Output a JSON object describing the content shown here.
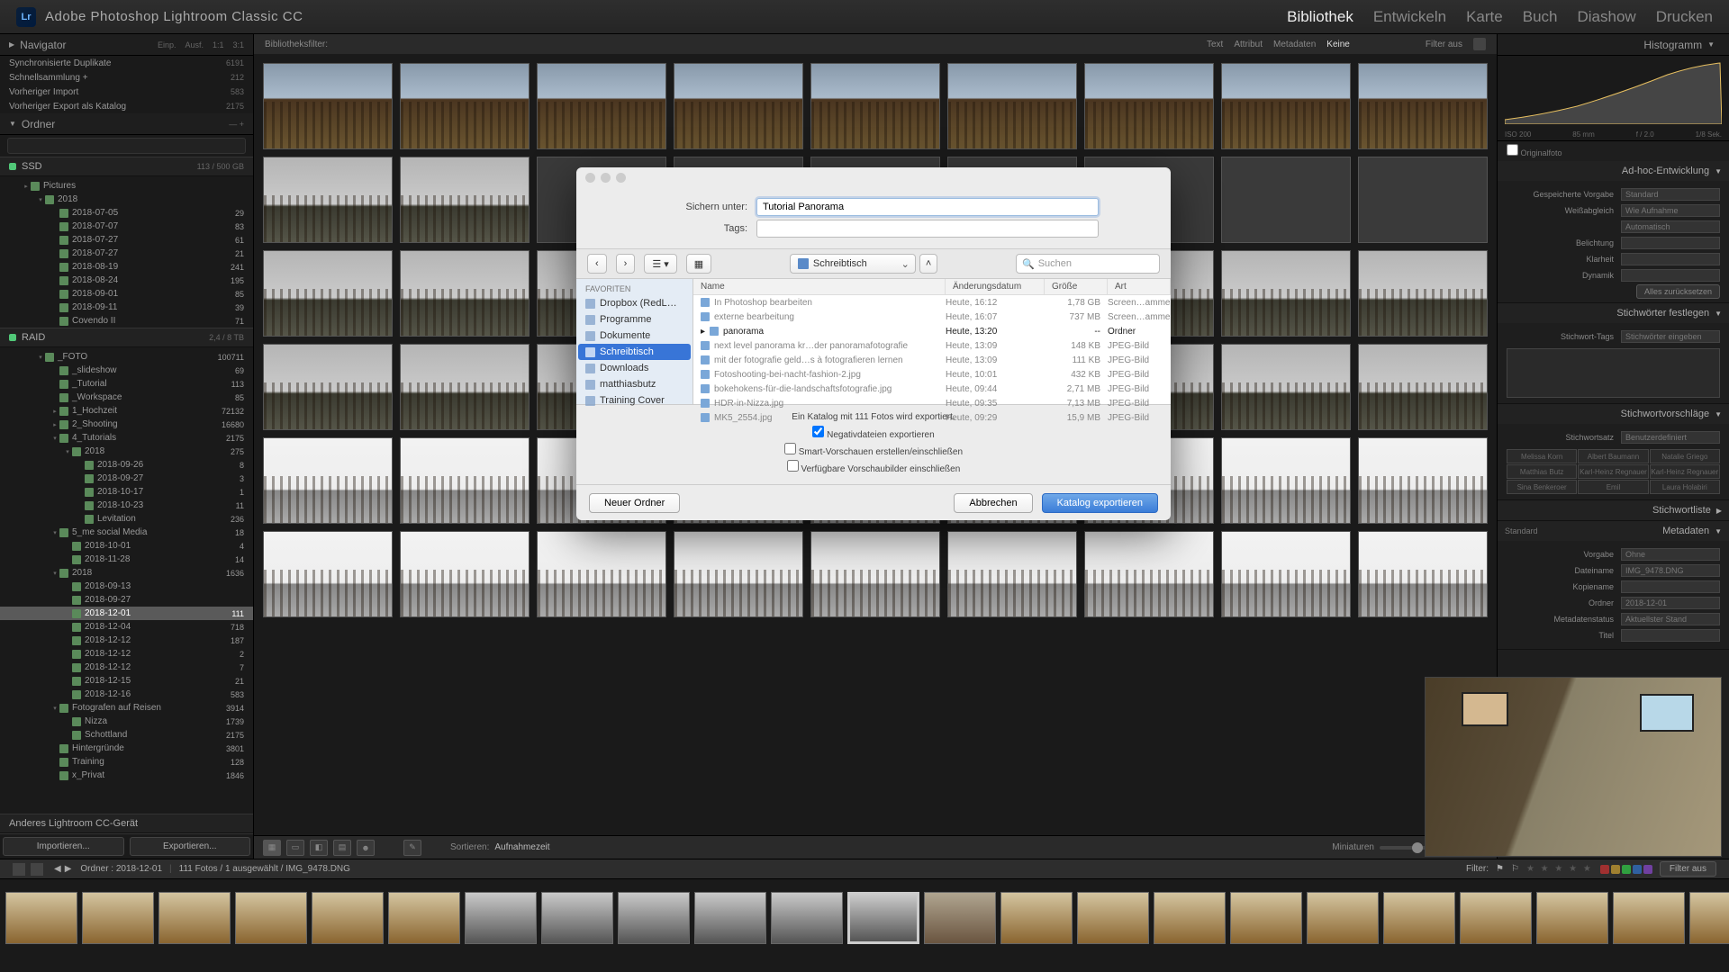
{
  "app": {
    "logo": "Lr",
    "title": "Adobe Photoshop Lightroom Classic CC"
  },
  "modules": [
    "Bibliothek",
    "Entwickeln",
    "Karte",
    "Buch",
    "Diashow",
    "Drucken"
  ],
  "activeModule": 0,
  "leftPanels": {
    "navigator": {
      "title": "Navigator",
      "fit": "Einp.",
      "fill": "Ausf.",
      "r1": "1:1",
      "r2": "3:1"
    },
    "catalog": {
      "items": [
        {
          "name": "Synchronisierte Duplikate",
          "count": "6191"
        },
        {
          "name": "Schnellsammlung  +",
          "count": "212"
        },
        {
          "name": "Vorheriger Import",
          "count": "583"
        },
        {
          "name": "Vorheriger Export als Katalog",
          "count": "2175"
        }
      ]
    },
    "folders": {
      "title": "Ordner",
      "plus": "+"
    },
    "volumes": [
      {
        "name": "SSD",
        "info": "113 / 500 GB"
      },
      {
        "name": "RAID",
        "info": "2,4 / 8 TB"
      }
    ],
    "tree": [
      {
        "pad": 24,
        "exp": "▸",
        "name": "Pictures",
        "count": ""
      },
      {
        "pad": 40,
        "exp": "▾",
        "name": "2018",
        "count": ""
      },
      {
        "pad": 56,
        "exp": "",
        "name": "2018-07-05",
        "count": "29"
      },
      {
        "pad": 56,
        "exp": "",
        "name": "2018-07-07",
        "count": "83"
      },
      {
        "pad": 56,
        "exp": "",
        "name": "2018-07-27",
        "count": "61"
      },
      {
        "pad": 56,
        "exp": "",
        "name": "2018-07-27",
        "count": "21"
      },
      {
        "pad": 56,
        "exp": "",
        "name": "2018-08-19",
        "count": "241"
      },
      {
        "pad": 56,
        "exp": "",
        "name": "2018-08-24",
        "count": "195"
      },
      {
        "pad": 56,
        "exp": "",
        "name": "2018-09-01",
        "count": "85"
      },
      {
        "pad": 56,
        "exp": "",
        "name": "2018-09-11",
        "count": "39"
      },
      {
        "pad": 56,
        "exp": "",
        "name": "Covendo II",
        "count": "71"
      }
    ],
    "tree2": [
      {
        "pad": 40,
        "exp": "▾",
        "name": "_FOTO",
        "count": "100711"
      },
      {
        "pad": 56,
        "exp": "",
        "name": "_slideshow",
        "count": "69"
      },
      {
        "pad": 56,
        "exp": "",
        "name": "_Tutorial",
        "count": "113"
      },
      {
        "pad": 56,
        "exp": "",
        "name": "_Workspace",
        "count": "85"
      },
      {
        "pad": 56,
        "exp": "▸",
        "name": "1_Hochzeit",
        "count": "72132"
      },
      {
        "pad": 56,
        "exp": "▸",
        "name": "2_Shooting",
        "count": "16680"
      },
      {
        "pad": 56,
        "exp": "▾",
        "name": "4_Tutorials",
        "count": "2175"
      },
      {
        "pad": 70,
        "exp": "▾",
        "name": "2018",
        "count": "275"
      },
      {
        "pad": 84,
        "exp": "",
        "name": "2018-09-26",
        "count": "8"
      },
      {
        "pad": 84,
        "exp": "",
        "name": "2018-09-27",
        "count": "3"
      },
      {
        "pad": 84,
        "exp": "",
        "name": "2018-10-17",
        "count": "1"
      },
      {
        "pad": 84,
        "exp": "",
        "name": "2018-10-23",
        "count": "11"
      },
      {
        "pad": 84,
        "exp": "",
        "name": "Levitation",
        "count": "236"
      },
      {
        "pad": 56,
        "exp": "▾",
        "name": "5_me social Media",
        "count": "18"
      },
      {
        "pad": 70,
        "exp": "",
        "name": "2018-10-01",
        "count": "4"
      },
      {
        "pad": 70,
        "exp": "",
        "name": "2018-11-28",
        "count": "14"
      },
      {
        "pad": 56,
        "exp": "▾",
        "name": "2018",
        "count": "1636"
      },
      {
        "pad": 70,
        "exp": "",
        "name": "2018-09-13",
        "count": ""
      },
      {
        "pad": 70,
        "exp": "",
        "name": "2018-09-27",
        "count": ""
      },
      {
        "pad": 70,
        "exp": "",
        "name": "2018-12-01",
        "count": "111",
        "sel": true
      },
      {
        "pad": 70,
        "exp": "",
        "name": "2018-12-04",
        "count": "718"
      },
      {
        "pad": 70,
        "exp": "",
        "name": "2018-12-12",
        "count": "187"
      },
      {
        "pad": 70,
        "exp": "",
        "name": "2018-12-12",
        "count": "2"
      },
      {
        "pad": 70,
        "exp": "",
        "name": "2018-12-12",
        "count": "7"
      },
      {
        "pad": 70,
        "exp": "",
        "name": "2018-12-15",
        "count": "21"
      },
      {
        "pad": 70,
        "exp": "",
        "name": "2018-12-16",
        "count": "583"
      },
      {
        "pad": 56,
        "exp": "▾",
        "name": "Fotografen auf Reisen",
        "count": "3914"
      },
      {
        "pad": 70,
        "exp": "",
        "name": "Nizza",
        "count": "1739"
      },
      {
        "pad": 70,
        "exp": "",
        "name": "Schottland",
        "count": "2175"
      },
      {
        "pad": 56,
        "exp": "",
        "name": "Hintergründe",
        "count": "3801"
      },
      {
        "pad": 56,
        "exp": "",
        "name": "Training",
        "count": "128"
      },
      {
        "pad": 56,
        "exp": "",
        "name": "x_Privat",
        "count": "1846"
      }
    ],
    "otherDevice": "Anderes Lightroom CC-Gerät",
    "import": "Importieren...",
    "export": "Exportieren..."
  },
  "filterbar": {
    "title": "Bibliotheksfilter:",
    "tabs": [
      "Text",
      "Attribut",
      "Metadaten",
      "Keine"
    ],
    "right": "Filter aus"
  },
  "gridtool": {
    "sort": "Sortieren:",
    "sortval": "Aufnahmezeit",
    "miniLabel": "Miniaturen"
  },
  "status": {
    "path": "Ordner : 2018-12-01",
    "info": "111 Fotos / 1 ausgewählt / IMG_9478.DNG",
    "filter": "Filter:",
    "filteroff": "Filter aus"
  },
  "rightPanels": {
    "histogram": {
      "title": "Histogramm",
      "iso": "ISO 200",
      "focal": "85 mm",
      "aperture": "f / 2.0",
      "shutter": "1/8 Sek.",
      "original": "Originalfoto"
    },
    "quickdev": {
      "title": "Ad-hoc-Entwicklung",
      "rows": [
        {
          "lbl": "Gespeicherte Vorgabe",
          "val": "Standard"
        },
        {
          "lbl": "Weißabgleich",
          "val": "Wie Aufnahme"
        },
        {
          "lbl": "",
          "val": "Automatisch"
        },
        {
          "lbl": "Belichtung",
          "val": ""
        },
        {
          "lbl": "Klarheit",
          "val": ""
        },
        {
          "lbl": "Dynamik",
          "val": ""
        }
      ],
      "reset": "Alles zurücksetzen"
    },
    "keywords": {
      "title": "Stichwörter festlegen",
      "tags": "Stichwort-Tags",
      "tagsval": "Stichwörter eingeben"
    },
    "keysugg": {
      "title": "Stichwortvorschläge",
      "set": "Stichwortsatz",
      "setval": "Benutzerdefiniert",
      "grid": [
        "Melissa Korn",
        "Albert Baumann",
        "Natalie Griego",
        "Matthias Butz",
        "Karl-Heinz Regnauer",
        "Karl-Heinz Regnauer",
        "Sina Benkeroer",
        "Emil",
        "Laura Holabiri"
      ]
    },
    "keylist": {
      "title": "Stichwortliste"
    },
    "metadata": {
      "title": "Metadaten",
      "std": "Standard",
      "rows": [
        {
          "lbl": "Vorgabe",
          "val": "Ohne"
        },
        {
          "lbl": "Dateiname",
          "val": "IMG_9478.DNG"
        },
        {
          "lbl": "Kopiename",
          "val": ""
        },
        {
          "lbl": "Ordner",
          "val": "2018-12-01"
        },
        {
          "lbl": "Metadatenstatus",
          "val": "Aktuellster Stand"
        },
        {
          "lbl": "Titel",
          "val": ""
        }
      ]
    }
  },
  "dialog": {
    "saveAs": "Sichern unter:",
    "filename": "Tutorial Panorama",
    "tags": "Tags:",
    "location": "Schreibtisch",
    "searchPH": "Suchen",
    "favHead": "Favoriten",
    "sidebar": [
      {
        "name": "Dropbox (RedL…"
      },
      {
        "name": "Programme"
      },
      {
        "name": "Dokumente"
      },
      {
        "name": "Schreibtisch",
        "sel": true
      },
      {
        "name": "Downloads"
      },
      {
        "name": "matthiasbutz"
      },
      {
        "name": "Training Cover"
      }
    ],
    "cols": {
      "name": "Name",
      "date": "Änderungsdatum",
      "size": "Größe",
      "type": "Art"
    },
    "files": [
      {
        "name": "In Photoshop bearbeiten",
        "date": "Heute, 16:12",
        "size": "1,78 GB",
        "type": "Screen…amme",
        "dim": true
      },
      {
        "name": "externe bearbeitung",
        "date": "Heute, 16:07",
        "size": "737 MB",
        "type": "Screen…amme",
        "dim": true
      },
      {
        "name": "panorama",
        "date": "Heute, 13:20",
        "size": "--",
        "type": "Ordner",
        "dim": false,
        "folder": true
      },
      {
        "name": "next level panorama kr…der panoramafotografie",
        "date": "Heute, 13:09",
        "size": "148 KB",
        "type": "JPEG-Bild",
        "dim": true
      },
      {
        "name": "mit der fotografie geld…s à fotografieren lernen",
        "date": "Heute, 13:09",
        "size": "111 KB",
        "type": "JPEG-Bild",
        "dim": true
      },
      {
        "name": "Fotoshooting-bei-nacht-fashion-2.jpg",
        "date": "Heute, 10:01",
        "size": "432 KB",
        "type": "JPEG-Bild",
        "dim": true
      },
      {
        "name": "bokehokens-für-die-landschaftsfotografie.jpg",
        "date": "Heute, 09:44",
        "size": "2,71 MB",
        "type": "JPEG-Bild",
        "dim": true
      },
      {
        "name": "HDR-in-Nizza.jpg",
        "date": "Heute, 09:35",
        "size": "7,13 MB",
        "type": "JPEG-Bild",
        "dim": true
      },
      {
        "name": "MK5_2554.jpg",
        "date": "Heute, 09:29",
        "size": "15,9 MB",
        "type": "JPEG-Bild",
        "dim": true
      }
    ],
    "info": "Ein Katalog mit 111 Fotos wird exportiert.",
    "opt1": "Negativdateien exportieren",
    "opt2": "Smart-Vorschauen erstellen/einschließen",
    "opt3": "Verfügbare Vorschaubilder einschließen",
    "newFolder": "Neuer Ordner",
    "cancel": "Abbrechen",
    "confirm": "Katalog exportieren"
  }
}
